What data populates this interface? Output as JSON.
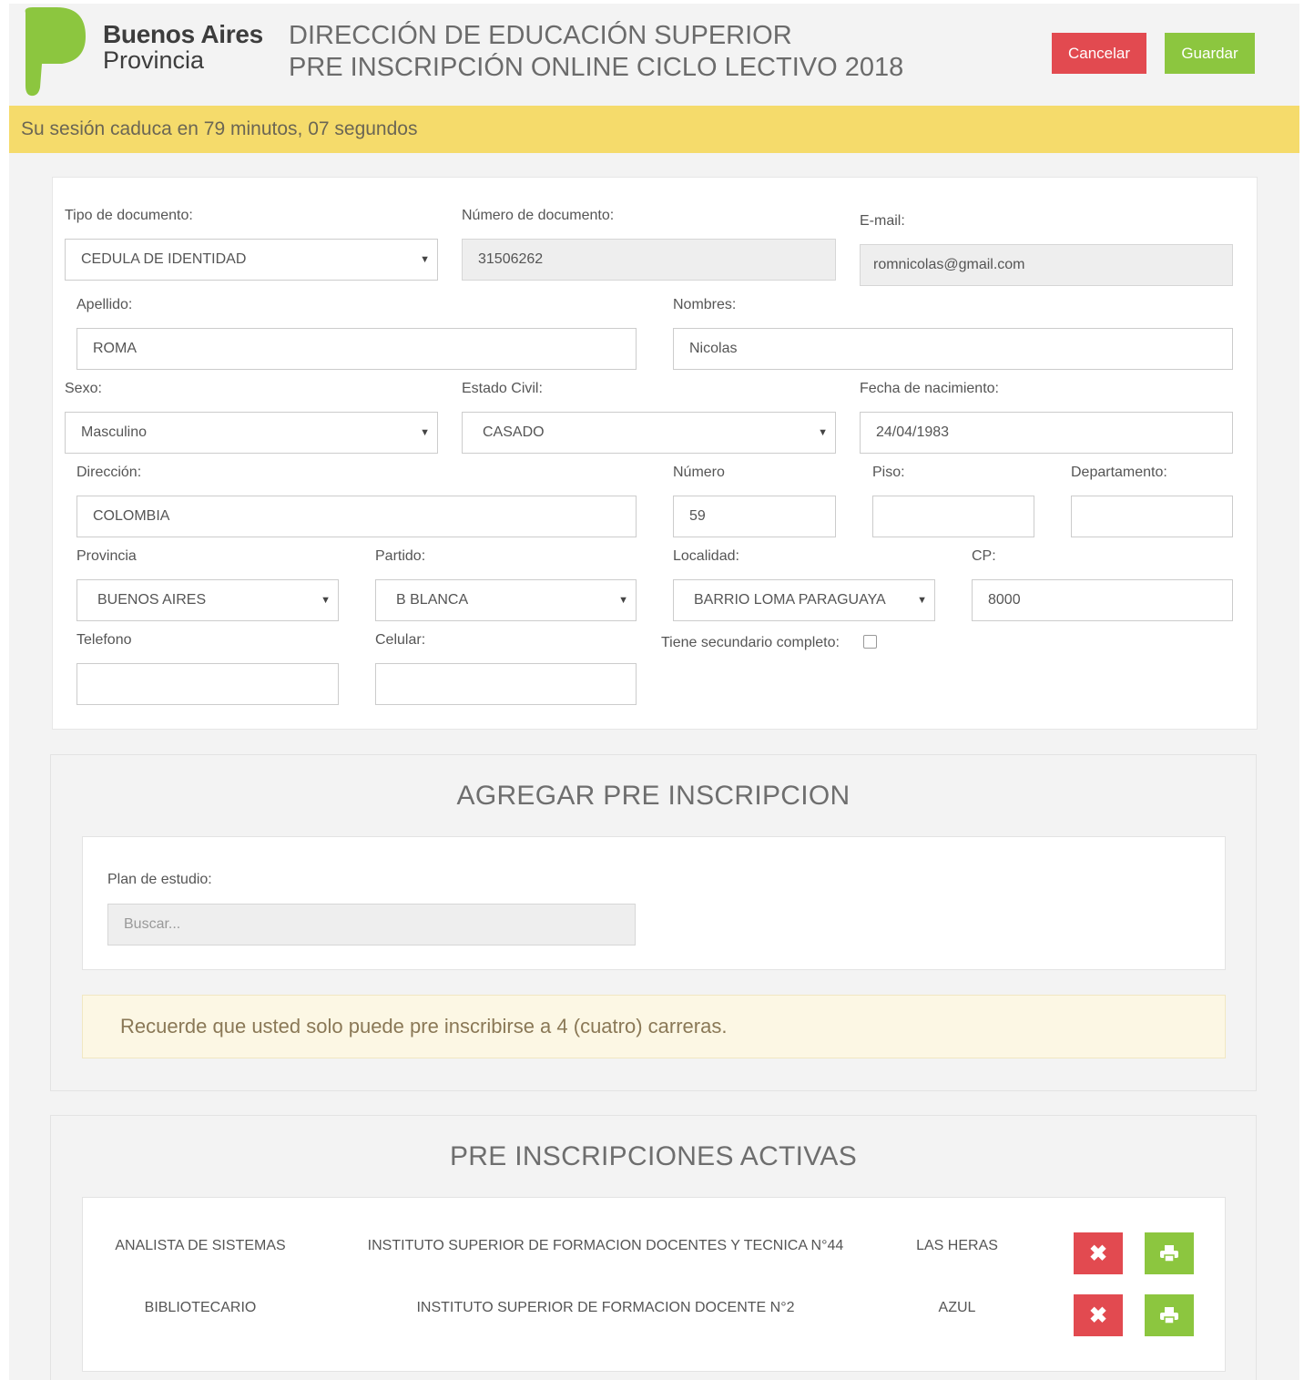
{
  "brand": {
    "line1": "Buenos Aires",
    "line2": "Provincia",
    "logo_color": "#8cc63f"
  },
  "header": {
    "title_line1": "DIRECCIÓN DE EDUCACIÓN SUPERIOR",
    "title_line2": "PRE INSCRIPCIÓN ONLINE CICLO LECTIVO 2018",
    "cancel_label": "Cancelar",
    "save_label": "Guardar"
  },
  "session": {
    "text": "Su sesión caduca en 79 minutos, 07 segundos"
  },
  "form": {
    "tipo_documento": {
      "label": "Tipo de documento:",
      "value": "CEDULA DE IDENTIDAD"
    },
    "numero_documento": {
      "label": "Número de documento:",
      "value": "31506262"
    },
    "email": {
      "label": "E-mail:",
      "value": "romnicolas@gmail.com"
    },
    "apellido": {
      "label": "Apellido:",
      "value": "ROMA"
    },
    "nombres": {
      "label": "Nombres:",
      "value": "Nicolas"
    },
    "sexo": {
      "label": "Sexo:",
      "value": "Masculino"
    },
    "estado_civil": {
      "label": "Estado Civil:",
      "value": "CASADO"
    },
    "fecha_nacimiento": {
      "label": "Fecha de nacimiento:",
      "value": "24/04/1983"
    },
    "direccion": {
      "label": "Dirección:",
      "value": "COLOMBIA"
    },
    "numero": {
      "label": "Número",
      "value": "59"
    },
    "piso": {
      "label": "Piso:",
      "value": ""
    },
    "departamento": {
      "label": "Departamento:",
      "value": ""
    },
    "provincia": {
      "label": "Provincia",
      "value": "BUENOS AIRES"
    },
    "partido": {
      "label": "Partido:",
      "value": "B BLANCA"
    },
    "localidad": {
      "label": "Localidad:",
      "value": "BARRIO LOMA PARAGUAYA"
    },
    "cp": {
      "label": "CP:",
      "value": "8000"
    },
    "telefono": {
      "label": "Telefono",
      "value": ""
    },
    "celular": {
      "label": "Celular:",
      "value": ""
    },
    "secundario": {
      "label": "Tiene secundario completo:",
      "checked": false
    }
  },
  "add_section": {
    "title": "AGREGAR PRE INSCRIPCION",
    "plan_label": "Plan de estudio:",
    "plan_placeholder": "Buscar...",
    "notice": "Recuerde que usted solo puede pre inscribirse a 4 (cuatro) carreras."
  },
  "active_section": {
    "title": "PRE INSCRIPCIONES ACTIVAS",
    "rows": [
      {
        "carrera": "ANALISTA DE SISTEMAS",
        "instituto": "INSTITUTO SUPERIOR DE FORMACION DOCENTES Y TECNICA N°44",
        "localidad": "LAS HERAS",
        "delete_icon": "times-icon",
        "print_icon": "print-icon"
      },
      {
        "carrera": "BIBLIOTECARIO",
        "instituto": "INSTITUTO SUPERIOR DE FORMACION DOCENTE N°2",
        "localidad": "AZUL",
        "delete_icon": "times-icon",
        "print_icon": "print-icon"
      }
    ]
  },
  "colors": {
    "danger": "#e24a50",
    "success": "#8cc63f",
    "session_bar": "#f5db6b",
    "notice_bg": "#fcf7e4"
  }
}
